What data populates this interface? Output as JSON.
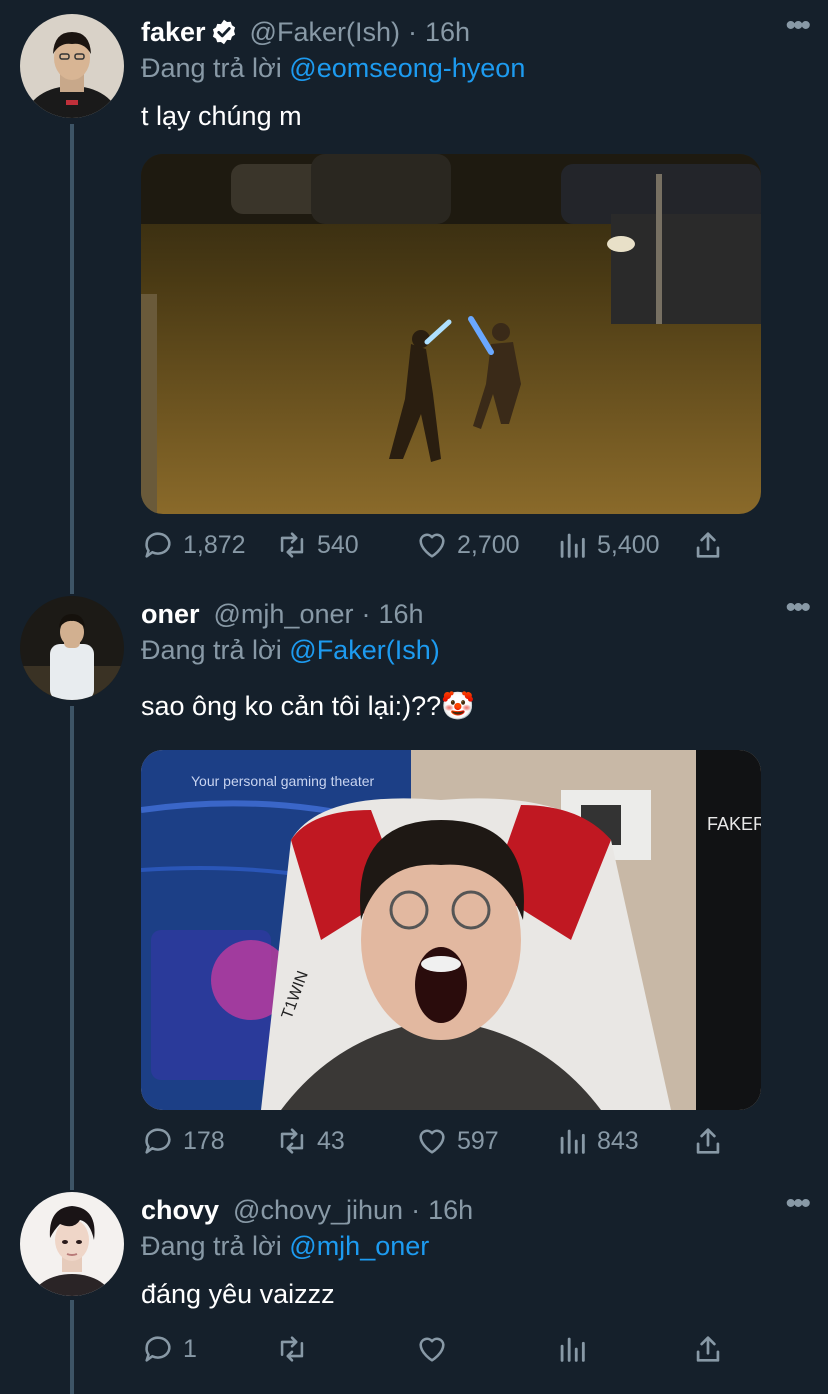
{
  "tweets": [
    {
      "name": "faker",
      "verified": true,
      "handle": "@Faker(Ish)",
      "separator": "·",
      "time": "16h",
      "reply_prefix": "Đang trả lời",
      "reply_to": "@eomseong-hyeon",
      "text": "t lạy chúng m",
      "media": "video-still-lightsaber-night",
      "stats": {
        "replies": "1,872",
        "retweets": "540",
        "likes": "2,700",
        "views": "5,400"
      }
    },
    {
      "name": "oner",
      "verified": false,
      "handle": "@mjh_oner",
      "separator": "·",
      "time": "16h",
      "reply_prefix": "Đang trả lời",
      "reply_to": "@Faker(Ish)",
      "text": "sao ông ko cản tôi lại:)??🤡",
      "media": "gaming-chair-yawn-photo",
      "media_text": {
        "banner": "Your personal gaming theater",
        "chair": "T1WIN",
        "jersey": "FAKER"
      },
      "stats": {
        "replies": "178",
        "retweets": "43",
        "likes": "597",
        "views": "843"
      }
    },
    {
      "name": "chovy",
      "verified": false,
      "handle": "@chovy_jihun",
      "separator": "·",
      "time": "16h",
      "reply_prefix": "Đang trả lời",
      "reply_to": "@mjh_oner",
      "text": "đáng yêu vaizzz",
      "stats": {
        "replies": "1",
        "retweets": "",
        "likes": "",
        "views": ""
      }
    }
  ],
  "more_label": "•••",
  "colors": {
    "background": "#15202b",
    "secondary": "#8899a6",
    "link": "#1d9bf0",
    "thread": "#3d5466"
  }
}
